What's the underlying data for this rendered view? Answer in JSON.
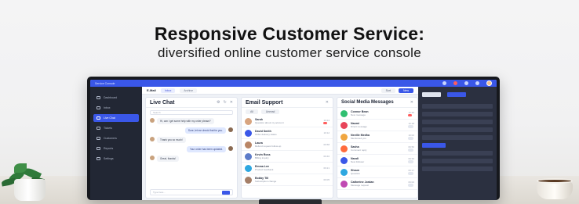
{
  "headline": "Responsive Customer Service:",
  "subheadline": "diversified online customer service console",
  "app": {
    "brand": "Service Console",
    "sidebar": [
      {
        "label": "Dashboard",
        "active": false
      },
      {
        "label": "Inbox",
        "active": false
      },
      {
        "label": "Live Chat",
        "active": true
      },
      {
        "label": "Tickets",
        "active": false
      },
      {
        "label": "Customers",
        "active": false
      },
      {
        "label": "Reports",
        "active": false
      },
      {
        "label": "Settings",
        "active": false
      }
    ],
    "tabs": {
      "title": "E-Mail",
      "items": [
        "Inbox",
        "Archive"
      ],
      "right_buttons": [
        "Sort",
        "New"
      ]
    },
    "live_chat": {
      "title": "Live Chat",
      "search_placeholder": "Search",
      "messages": [
        {
          "side": "left",
          "text": "Hi, can I get some help with my order please?"
        },
        {
          "side": "right",
          "text": "Sure, let me check that for you."
        },
        {
          "side": "left",
          "text": "Thank you so much!"
        },
        {
          "side": "right",
          "text": "Your order has been updated."
        },
        {
          "side": "left",
          "text": "Great, thanks!"
        }
      ],
      "input_placeholder": "Type here..."
    },
    "email_support": {
      "title": "Email Support",
      "filters": [
        "All",
        "Unread"
      ],
      "rows": [
        {
          "name": "Sarah",
          "sub": "Question about my account",
          "time": "10:24"
        },
        {
          "name": "David Smith",
          "sub": "Order delivery status",
          "time": "10:12"
        },
        {
          "name": "Laura",
          "sub": "Refund request follow-up",
          "time": "09:58"
        },
        {
          "name": "Kevin Ross",
          "sub": "Billing inquiry",
          "time": "09:40"
        },
        {
          "name": "Emma Lee",
          "sub": "Product feedback",
          "time": "09:21"
        },
        {
          "name": "Bobby Till",
          "sub": "Subscription change",
          "time": "09:05"
        }
      ]
    },
    "social": {
      "title": "Social Media Messages",
      "rows": [
        {
          "name": "Connor Bean",
          "sub": "New message",
          "time": "10:30",
          "color": "#2fbf71"
        },
        {
          "name": "Naomi",
          "sub": "Direct message",
          "time": "10:18",
          "color": "#e8455a"
        },
        {
          "name": "Neville Medha",
          "sub": "Mentioned you",
          "time": "10:02",
          "color": "#f0a640"
        },
        {
          "name": "Sasha",
          "sub": "Comment reply",
          "time": "09:50",
          "color": "#ff6b3d"
        },
        {
          "name": "Nandi",
          "sub": "New follower",
          "time": "09:33",
          "color": "#3a57e8"
        },
        {
          "name": "Shaun",
          "sub": "Question",
          "time": "09:17",
          "color": "#2ea7e0"
        },
        {
          "name": "Catherine Jordan",
          "sub": "Message request",
          "time": "09:02",
          "color": "#c04ab3"
        }
      ]
    }
  },
  "colors": {
    "accent": "#3a57e8",
    "sidebar": "#222734",
    "alert": "#ff5d5d"
  }
}
